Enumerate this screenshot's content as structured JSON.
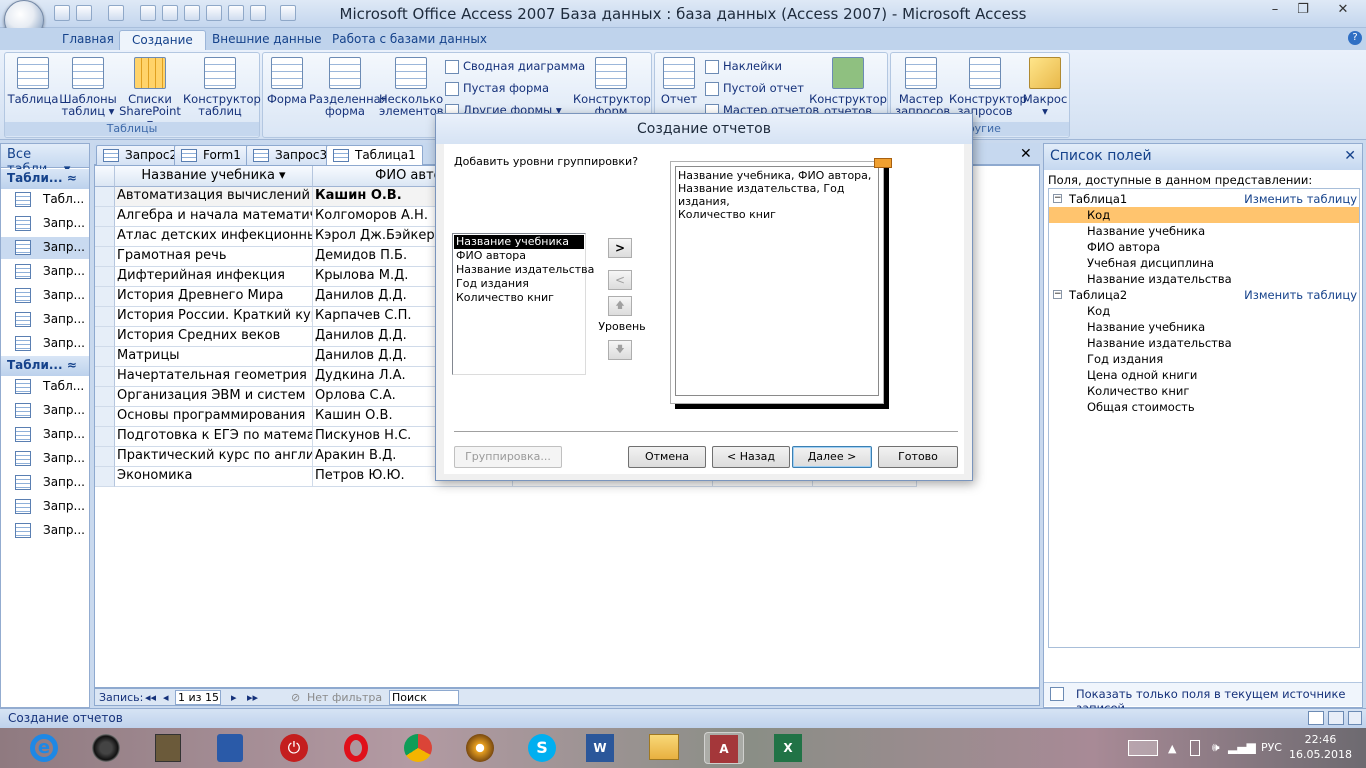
{
  "window": {
    "title": "Microsoft Office Access 2007 База данных : база данных (Access 2007) - Microsoft Access",
    "minimize": "–",
    "restore": "❐",
    "close": "✕"
  },
  "ribbon_tabs": [
    "Главная",
    "Создание",
    "Внешние данные",
    "Работа с базами данных"
  ],
  "ribbon": {
    "tables": {
      "label": "Таблицы",
      "btn1": "Таблица",
      "btn2": "Шаблоны таблиц ▾",
      "btn3": "Списки SharePoint ▾",
      "btn4": "Конструктор таблиц"
    },
    "forms": {
      "btn1": "Форма",
      "btn2": "Разделенная форма",
      "btn3": "Несколько элементов",
      "small1": "Сводная диаграмма",
      "small2": "Пустая форма",
      "small3": "Другие формы ▾",
      "btn4": "Конструктор форм"
    },
    "reports": {
      "btn1": "Отчет",
      "small1": "Наклейки",
      "small2": "Пустой отчет",
      "small3": "Мастер отчетов",
      "btn2": "Конструктор отчетов"
    },
    "other": {
      "label": "Другие",
      "btn1": "Мастер запросов",
      "btn2": "Конструктор запросов",
      "btn3": "Макрос ▾"
    }
  },
  "nav": {
    "header": "Все табли... ▾",
    "groups": [
      {
        "label": "Табли...  ≈",
        "items": [
          "Табл...",
          "Запр...",
          "Запр...",
          "Запр...",
          "Запр...",
          "Запр...",
          "Запр..."
        ]
      },
      {
        "label": "Табли...  ≈",
        "items": [
          "Табл...",
          "Запр...",
          "Запр...",
          "Запр...",
          "Запр...",
          "Запр...",
          "Запр..."
        ]
      }
    ]
  },
  "doc_tabs": [
    "Запрос2",
    "Form1",
    "Запрос3",
    "Таблица1"
  ],
  "grid": {
    "headers": [
      "Название учебника ▾",
      "ФИО автор"
    ],
    "rows": [
      [
        "Автоматизация вычислений",
        "Кашин О.В."
      ],
      [
        "Алгебра и начала математичес",
        "Колгоморов А.Н."
      ],
      [
        "Атлас детских инфекционных з",
        "Кэрол Дж.Бэйкер"
      ],
      [
        "Грамотная речь",
        "Демидов П.Б."
      ],
      [
        "Дифтерийная инфекция",
        "Крылова М.Д."
      ],
      [
        "История Древнего Мира",
        "Данилов Д.Д."
      ],
      [
        "История России. Краткий курс.",
        "Карпачев С.П."
      ],
      [
        "История Средних веков",
        "Данилов Д.Д."
      ],
      [
        "Матрицы",
        "Данилов Д.Д."
      ],
      [
        "Начертательная геометрия",
        "Дудкина Л.А."
      ],
      [
        "Организация ЭВМ и систем",
        "Орлова С.А."
      ],
      [
        "Основы программирования",
        "Кашин О.В."
      ],
      [
        "Подготовка к ЕГЭ по математи",
        "Пискунов Н.С."
      ],
      [
        "Практический курс по английс",
        "Аракин В.Д."
      ],
      [
        "Экономика",
        "Петров Ю.Ю."
      ]
    ]
  },
  "record_nav": {
    "label": "Запись:",
    "first": "◂◂",
    "prev": "◂",
    "current": "1 из 15",
    "next": "▸",
    "last": "▸▸",
    "filter": "Нет фильтра",
    "search": "Поиск"
  },
  "field_list": {
    "title": "Список полей",
    "subtitle": "Поля, доступные в данном представлении:",
    "tables": [
      {
        "name": "Таблица1",
        "edit": "Изменить таблицу",
        "fields": [
          "Код",
          "Название учебника",
          "ФИО автора",
          "Учебная дисциплина",
          "Название издательства"
        ]
      },
      {
        "name": "Таблица2",
        "edit": "Изменить таблицу",
        "fields": [
          "Код",
          "Название учебника",
          "Название издательства",
          "Год издания",
          "Цена одной книги",
          "Количество книг",
          "Общая стоимость"
        ]
      }
    ],
    "bottom": "Показать только поля в текущем источнике записей"
  },
  "status": "Создание отчетов",
  "dialog": {
    "title": "Создание отчетов",
    "prompt": "Добавить уровни группировки?",
    "available": [
      "Название учебника",
      "ФИО автора",
      "Название издательства",
      "Год издания",
      "Количество книг"
    ],
    "preview_lines": [
      "Название учебника, ФИО автора,",
      "Название издательства, Год издания,",
      "Количество книг"
    ],
    "add": ">",
    "remove": "<",
    "up": "🡅",
    "down": "🡇",
    "level": "Уровень",
    "btn_grouping": "Группировка...",
    "btn_cancel": "Отмена",
    "btn_back": "< Назад",
    "btn_next": "Далее >",
    "btn_finish": "Готово"
  },
  "taskbar": {
    "lang": "РУС",
    "time": "22:46",
    "date": "16.05.2018"
  }
}
